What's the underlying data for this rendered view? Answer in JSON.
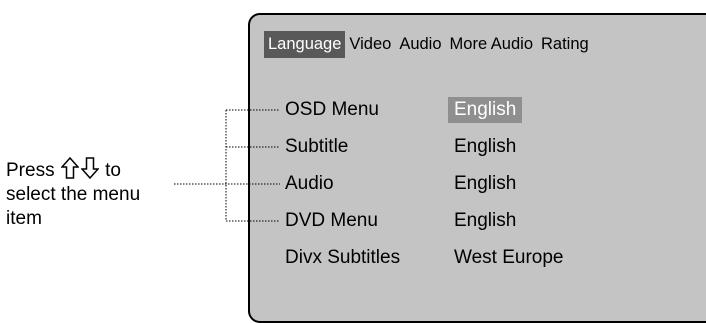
{
  "instruction": {
    "line1_prefix": "Press",
    "line1_suffix": "to",
    "line2": "select the menu",
    "line3": "item",
    "icons": [
      "up-arrow-icon",
      "down-arrow-icon"
    ]
  },
  "menu": {
    "tabs": [
      {
        "label": "Language",
        "active": true
      },
      {
        "label": "Video",
        "active": false
      },
      {
        "label": "Audio",
        "active": false
      },
      {
        "label": "More Audio",
        "active": false
      },
      {
        "label": "Rating",
        "active": false
      }
    ],
    "rows": [
      {
        "label": "OSD Menu",
        "value": "English",
        "selected": true
      },
      {
        "label": "Subtitle",
        "value": "English",
        "selected": false
      },
      {
        "label": "Audio",
        "value": "English",
        "selected": false
      },
      {
        "label": "DVD Menu",
        "value": "English",
        "selected": false
      },
      {
        "label": "Divx Subtitles",
        "value": "West Europe",
        "selected": false
      }
    ]
  },
  "colors": {
    "panel_background": "#c4c4c4",
    "active_tab": "#595959",
    "selected_value": "#8f8f8f"
  }
}
